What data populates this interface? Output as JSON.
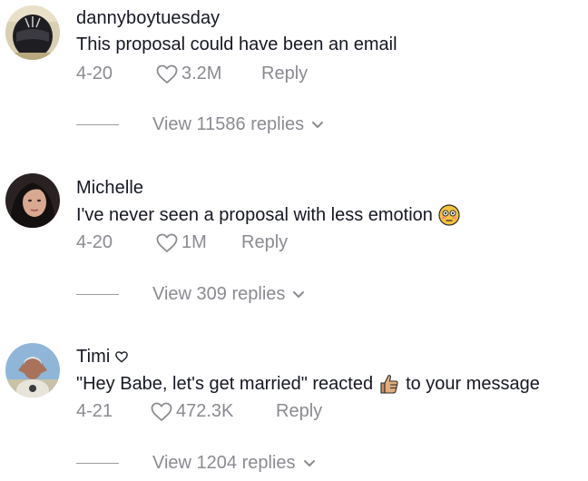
{
  "comments": [
    {
      "username": "dannyboytuesday",
      "text": "This proposal could have been an email",
      "date": "4-20",
      "likes": "3.2M",
      "reply_label": "Reply",
      "view_replies": "View 11586 replies",
      "avatar_icon": "helmet-avatar"
    },
    {
      "username": "Michelle",
      "text": "I've never seen a proposal with less emotion",
      "emoji": "flushed-face-icon",
      "date": "4-20",
      "likes": "1M",
      "reply_label": "Reply",
      "view_replies": "View 309 replies",
      "avatar_icon": "woman-avatar"
    },
    {
      "username": "Timi",
      "username_icon": "small-heart-icon",
      "text_before": "\"Hey Babe, let's get married\" reacted",
      "emoji": "thumbs-up-icon",
      "text_after": "to your message",
      "date": "4-21",
      "likes": "472.3K",
      "reply_label": "Reply",
      "view_replies": "View 1204 replies",
      "avatar_icon": "man-avatar"
    }
  ],
  "colors": {
    "text": "#161823",
    "muted": "#8a8b91"
  }
}
